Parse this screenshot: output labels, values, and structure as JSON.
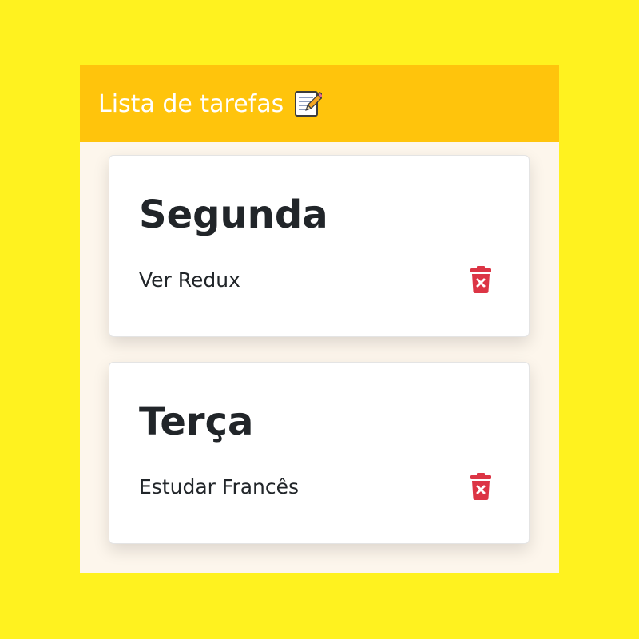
{
  "header": {
    "title": "Lista de tarefas",
    "icon": "memo-icon"
  },
  "cards": [
    {
      "day": "Segunda",
      "tasks": [
        {
          "text": "Ver Redux",
          "delete_icon": "trash-x-icon"
        }
      ]
    },
    {
      "day": "Terça",
      "tasks": [
        {
          "text": "Estudar Francês",
          "delete_icon": "trash-x-icon"
        }
      ]
    }
  ],
  "colors": {
    "page_background": "#fff21f",
    "header_background": "#ffc40c",
    "panel_background": "#fdf6ec",
    "delete_icon": "#dc3545",
    "text": "#212529"
  }
}
